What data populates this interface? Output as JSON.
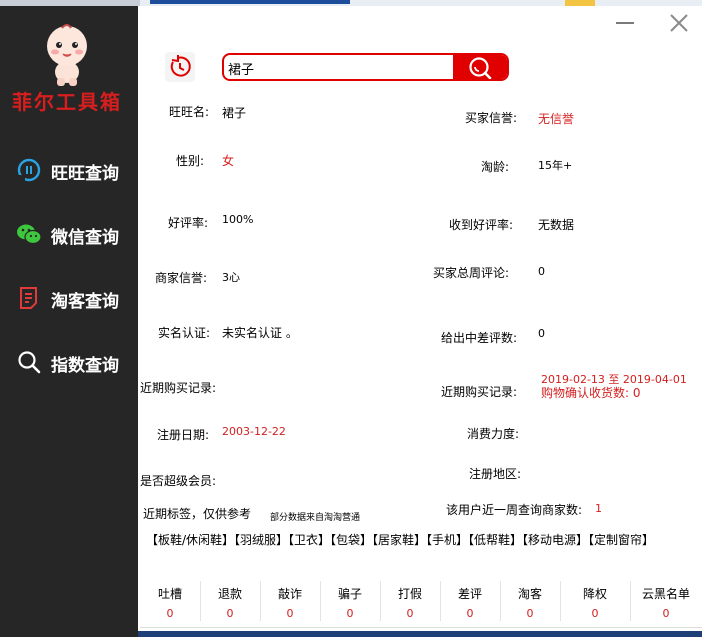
{
  "app": {
    "logo_text": "菲尔工具箱",
    "colors": {
      "sidebar_bg": "#262626",
      "accent_red": "#e00000",
      "value_red": "#d41e1e"
    }
  },
  "sidebar": {
    "items": [
      {
        "label": "旺旺查询",
        "icon": "wangwang-icon"
      },
      {
        "label": "微信查询",
        "icon": "wechat-icon"
      },
      {
        "label": "淘客查询",
        "icon": "document-icon"
      },
      {
        "label": "指数查询",
        "icon": "search-icon"
      }
    ]
  },
  "search": {
    "value": "裙子"
  },
  "fields": {
    "wangwang_name": {
      "label": "旺旺名:",
      "value": "裙子"
    },
    "buyer_credit": {
      "label": "买家信誉:",
      "value": "无信誉"
    },
    "gender": {
      "label": "性别:",
      "value": "女"
    },
    "tao_age": {
      "label": "淘龄:",
      "value": "15年+"
    },
    "good_rate": {
      "label": "好评率:",
      "value": "100%"
    },
    "received_good_rate": {
      "label": "收到好评率:",
      "value": "无数据"
    },
    "seller_credit": {
      "label": "商家信誉:",
      "value": "3心"
    },
    "buyer_weekly_reviews": {
      "label": "买家总周评论:",
      "value": "0"
    },
    "real_name": {
      "label": "实名认证:",
      "value": "未实名认证 。"
    },
    "given_bad_reviews": {
      "label": "给出中差评数:",
      "value": "0"
    },
    "recent_purchase_left": {
      "label": "近期购买记录:"
    },
    "recent_purchase_right": {
      "label": "近期购买记录:",
      "value_line1": "2019-02-13 至 2019-04-01",
      "value_line2": "购物确认收货数: 0"
    },
    "register_date": {
      "label": "注册日期:",
      "value": "2003-12-22"
    },
    "spending_power": {
      "label": "消费力度:"
    },
    "super_member": {
      "label": "是否超级会员:"
    },
    "register_region": {
      "label": "注册地区:"
    },
    "recent_tags": {
      "label": "近期标签，仅供参考",
      "note": "部分数据来自淘淘营通"
    },
    "weekly_queries": {
      "label": "该用户近一周查询商家数:",
      "value": "1"
    }
  },
  "tags": "【板鞋/休闲鞋】【羽绒服】【卫衣】【包袋】【居家鞋】【手机】【低帮鞋】【移动电源】【定制窗帘】",
  "stats": [
    {
      "name": "吐槽",
      "value": "0"
    },
    {
      "name": "退款",
      "value": "0"
    },
    {
      "name": "敲诈",
      "value": "0"
    },
    {
      "name": "骗子",
      "value": "0"
    },
    {
      "name": "打假",
      "value": "0"
    },
    {
      "name": "差评",
      "value": "0"
    },
    {
      "name": "淘客",
      "value": "0"
    },
    {
      "name": "降权",
      "value": "0"
    },
    {
      "name": "云黑名单",
      "value": "0"
    }
  ]
}
